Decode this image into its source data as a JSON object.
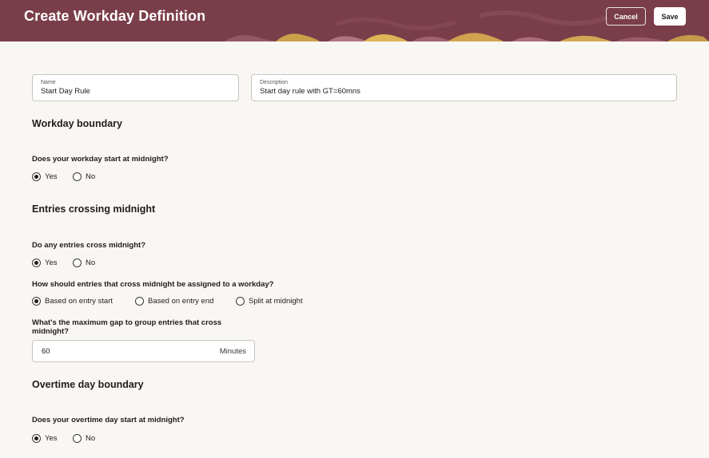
{
  "header": {
    "title": "Create Workday Definition",
    "cancel_label": "Cancel",
    "save_label": "Save",
    "background_color": "#7a3d4a"
  },
  "form": {
    "name": {
      "label": "Name",
      "value": "Start Day Rule"
    },
    "description": {
      "label": "Description",
      "value": "Start day rule with GT=60mns"
    }
  },
  "workday_boundary": {
    "heading": "Workday boundary",
    "question": "Does your workday start at midnight?",
    "options": [
      "Yes",
      "No"
    ],
    "selected": "Yes"
  },
  "entries_crossing": {
    "heading": "Entries crossing midnight",
    "cross_question": "Do any entries cross midnight?",
    "cross_options": [
      "Yes",
      "No"
    ],
    "cross_selected": "Yes",
    "assign_question": "How should entries that cross midnight be assigned to a workday?",
    "assign_options": [
      "Based on entry start",
      "Based on entry end",
      "Split at midnight"
    ],
    "assign_selected": "Based on entry start",
    "gap_question_line1": "What's the maximum gap to group entries that cross",
    "gap_question_line2": "midnight?",
    "gap_value": "60",
    "gap_unit": "Minutes"
  },
  "overtime_boundary": {
    "heading": "Overtime day boundary",
    "question": "Does your overtime day start at midnight?",
    "options": [
      "Yes",
      "No"
    ],
    "selected": "Yes"
  }
}
